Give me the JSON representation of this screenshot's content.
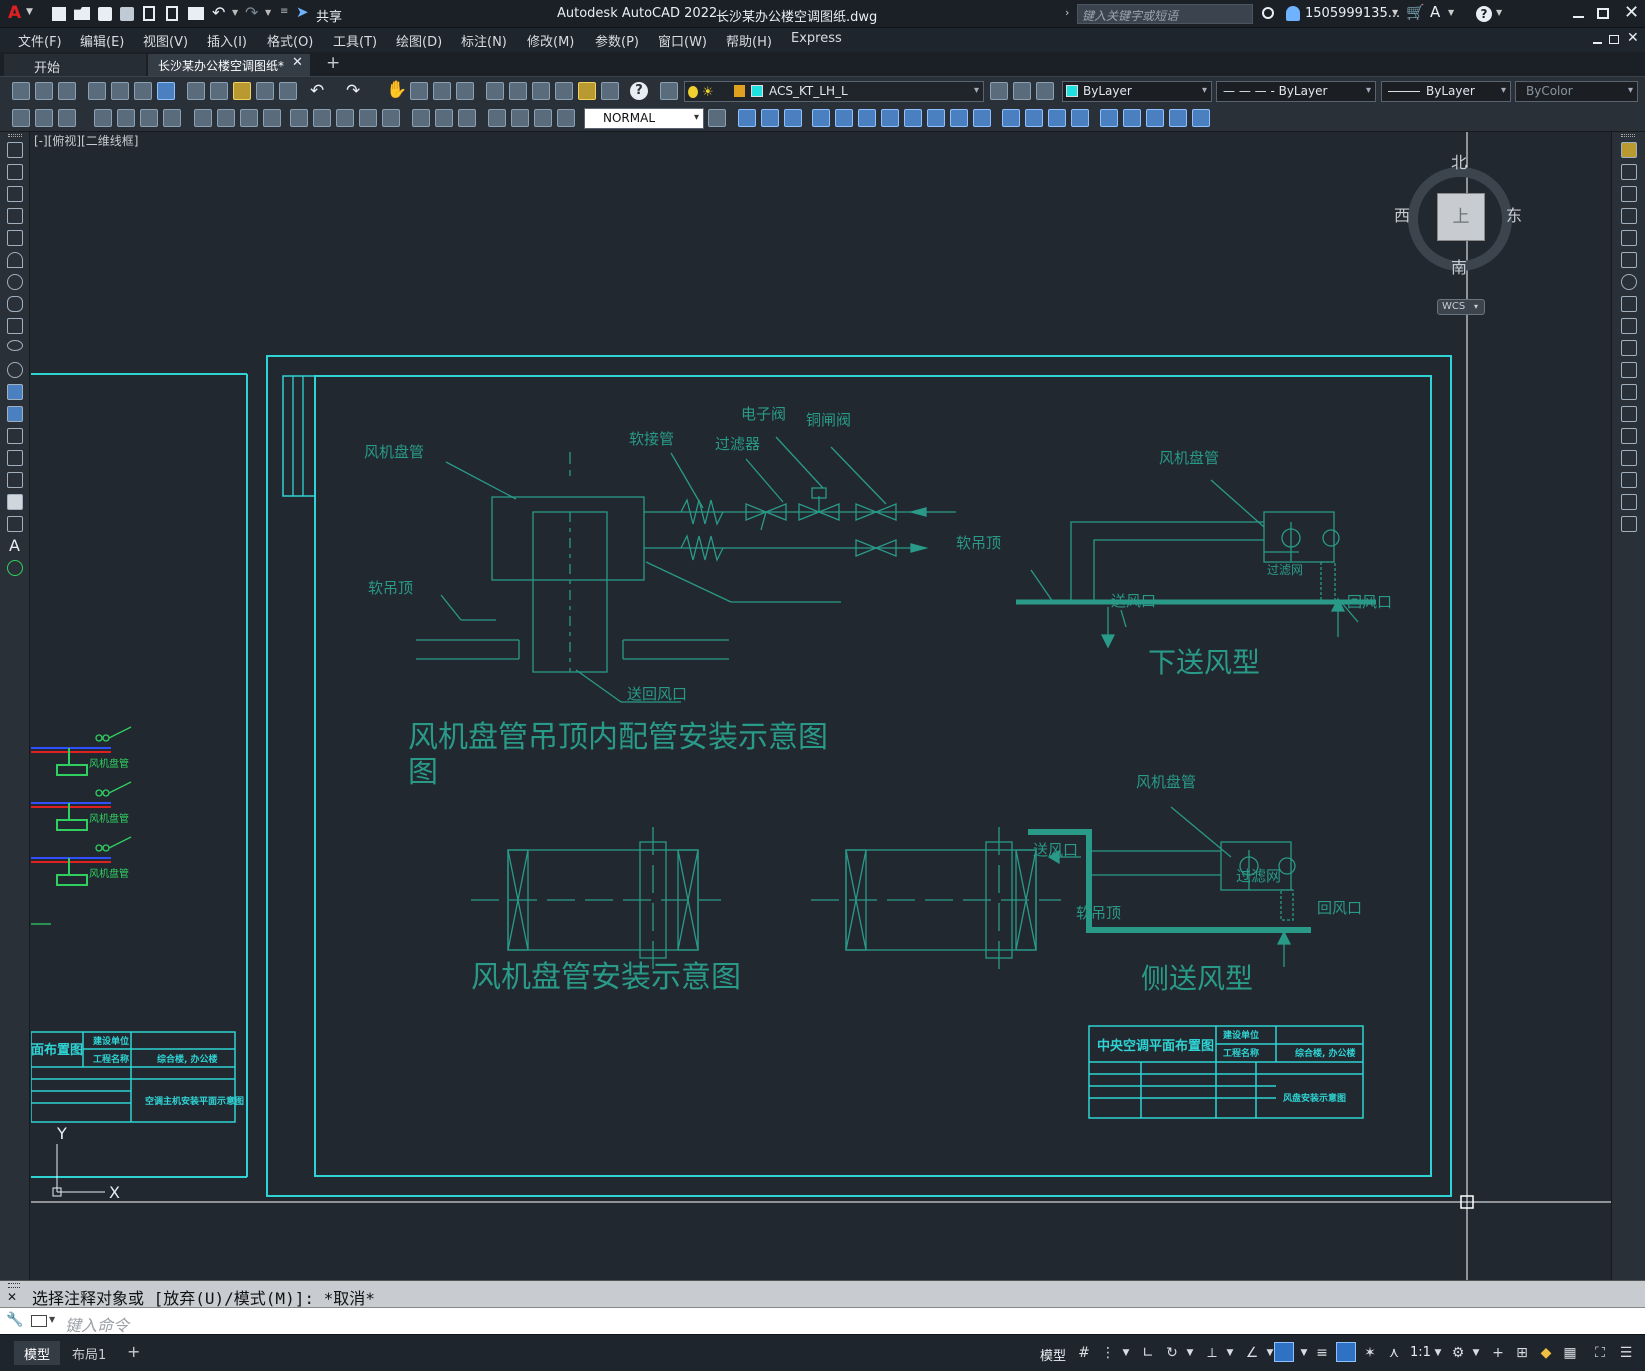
{
  "titlebar": {
    "logo": "A",
    "share_label": "共享",
    "app_title": "Autodesk AutoCAD 2022",
    "file_title": "长沙某办公楼空调图纸.dwg",
    "search_placeholder": "键入关键字或短语",
    "user": "1505999135...",
    "icons": [
      "new-icon",
      "open-icon",
      "save-icon",
      "saveas-icon",
      "plot-icon",
      "undo-icon",
      "redo-icon",
      "search-icon",
      "user-icon",
      "cart-icon",
      "help-icon",
      "minimize-icon",
      "maximize-icon",
      "close-icon"
    ]
  },
  "menubar": {
    "items": [
      "文件(F)",
      "编辑(E)",
      "视图(V)",
      "插入(I)",
      "格式(O)",
      "工具(T)",
      "绘图(D)",
      "标注(N)",
      "修改(M)",
      "参数(P)",
      "窗口(W)",
      "帮助(H)",
      "Express"
    ]
  },
  "tabs": {
    "items": [
      {
        "label": "开始",
        "active": false
      },
      {
        "label": "长沙某办公楼空调图纸*",
        "active": true
      }
    ],
    "add_label": "+"
  },
  "toolbar": {
    "layer_name": "ACS_KT_LH_L",
    "color": "ByLayer",
    "linetype": "— — — - ByLayer",
    "lineweight": "ByLayer",
    "plotstyle": "ByColor",
    "dimstyle": "NORMAL"
  },
  "viewport": {
    "label": "[-][俯视][二维线框]"
  },
  "viewcube": {
    "north": "北",
    "south": "南",
    "east": "东",
    "west": "西",
    "top": "上",
    "wcs": "WCS"
  },
  "drawing": {
    "left_labels": [
      "风机盘管",
      "软接管",
      "过滤器",
      "电子阀",
      "铜闸阀",
      "软吊顶",
      "送回风口"
    ],
    "title_main": "风机盘管吊顶内配管安装示意图",
    "title_main_wrap": "图",
    "title_install": "风机盘管安装示意图",
    "down_labels": [
      "风机盘管",
      "软吊顶",
      "过滤网",
      "送风口",
      "回风口"
    ],
    "title_down": "下送风型",
    "side_labels": [
      "风机盘管",
      "送风口",
      "过滤网",
      "软吊顶",
      "回风口"
    ],
    "title_side": "侧送风型",
    "left_sheet_labels": [
      "风机盘管",
      "风机盘管",
      "风机盘管"
    ],
    "titleblock_left": {
      "title": "面布置图",
      "unit": "建设单位",
      "proj": "工程名称",
      "proj_val": "综合楼, 办公楼",
      "drawing": "空调主机安装平面示意图"
    },
    "titleblock_right": {
      "title": "中央空调平面布置图",
      "unit": "建设单位",
      "proj": "工程名称",
      "proj_val": "综合楼, 办公楼",
      "drawing": "风盘安装示意图"
    },
    "ucs_x": "X",
    "ucs_y": "Y"
  },
  "command": {
    "history": "选择注释对象或 [放弃(U)/模式(M)]: *取消*",
    "placeholder": "键入命令"
  },
  "status": {
    "tabs": [
      "模型",
      "布局1"
    ],
    "add": "+",
    "model_label": "模型",
    "scale": "1:1"
  },
  "colors": {
    "cyan": "#2fd3d3",
    "drawing": "#2a9a88",
    "canvas": "#212830",
    "green": "#30d060",
    "red": "#e02020",
    "blue": "#3050ff"
  }
}
